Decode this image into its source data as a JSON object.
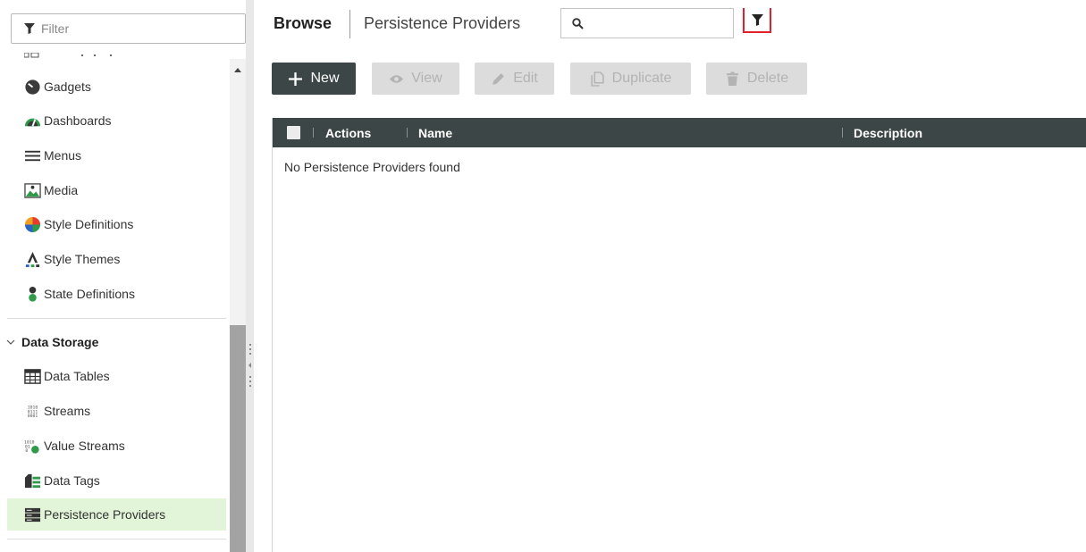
{
  "sidebar": {
    "filter_placeholder": "Filter",
    "items_top": [
      {
        "label": "Gadgets",
        "icon": "gadgets-icon"
      },
      {
        "label": "Dashboards",
        "icon": "dashboards-icon"
      },
      {
        "label": "Menus",
        "icon": "menus-icon"
      },
      {
        "label": "Media",
        "icon": "media-icon"
      },
      {
        "label": "Style Definitions",
        "icon": "style-definitions-icon"
      },
      {
        "label": "Style Themes",
        "icon": "style-themes-icon"
      },
      {
        "label": "State Definitions",
        "icon": "state-definitions-icon"
      }
    ],
    "section": {
      "label": "Data Storage"
    },
    "items_data": [
      {
        "label": "Data Tables",
        "icon": "data-tables-icon"
      },
      {
        "label": "Streams",
        "icon": "streams-icon"
      },
      {
        "label": "Value Streams",
        "icon": "value-streams-icon"
      },
      {
        "label": "Data Tags",
        "icon": "data-tags-icon"
      },
      {
        "label": "Persistence Providers",
        "icon": "persistence-providers-icon",
        "selected": true
      }
    ],
    "selection_color": "#e2f5d8"
  },
  "header": {
    "browse": "Browse",
    "crumb": "Persistence Providers",
    "search_value": "",
    "filter_highlight_color": "#e0212b"
  },
  "toolbar": {
    "new": "New",
    "view": "View",
    "edit": "Edit",
    "duplicate": "Duplicate",
    "delete": "Delete"
  },
  "grid": {
    "columns": [
      "Actions",
      "Name",
      "Description"
    ],
    "empty_message": "No Persistence Providers found",
    "header_color": "#3d4647"
  }
}
